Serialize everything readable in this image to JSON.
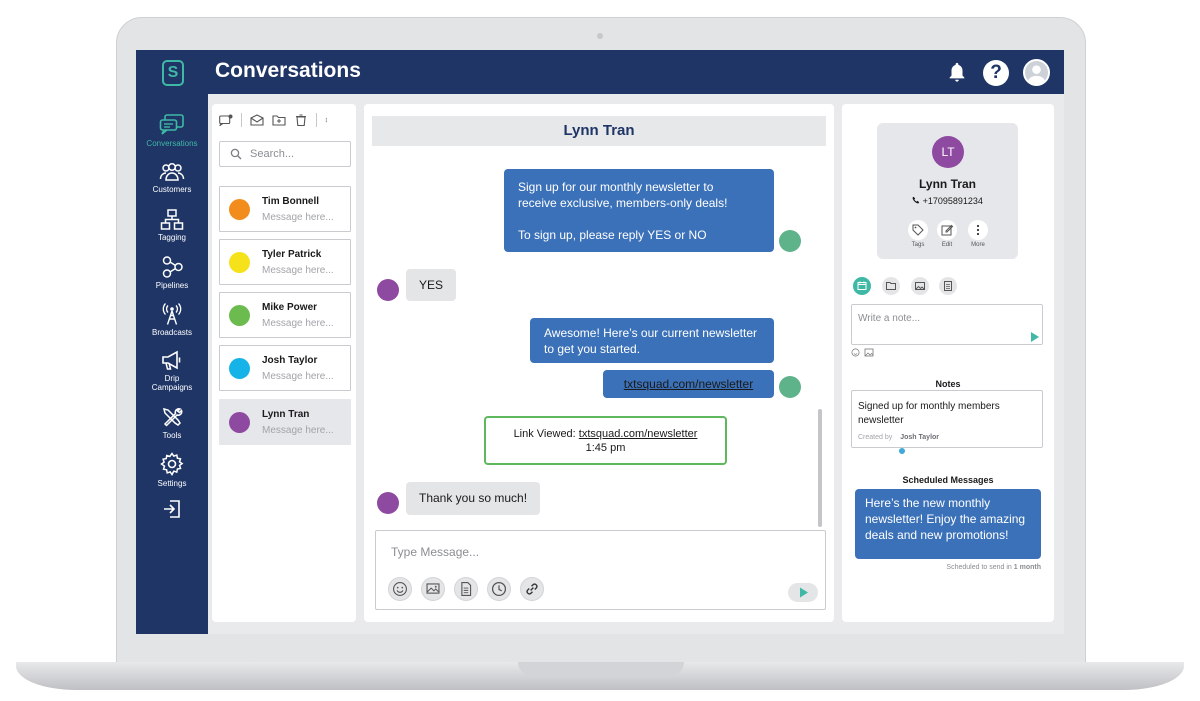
{
  "app": {
    "title": "Conversations"
  },
  "sidebar": {
    "items": [
      {
        "label": "Conversations",
        "icon": "chat-icon"
      },
      {
        "label": "Customers",
        "icon": "customers-icon"
      },
      {
        "label": "Tagging",
        "icon": "tagging-icon"
      },
      {
        "label": "Pipelines",
        "icon": "pipelines-icon"
      },
      {
        "label": "Broadcasts",
        "icon": "broadcast-icon"
      },
      {
        "label": "Drip",
        "label2": "Campaigns",
        "icon": "megaphone-icon"
      },
      {
        "label": "Tools",
        "icon": "tools-icon"
      },
      {
        "label": "Settings",
        "icon": "gear-icon"
      }
    ]
  },
  "list": {
    "search_placeholder": "Search...",
    "contacts": [
      {
        "name": "Tim Bonnell",
        "preview": "Message here...",
        "color": "#f28c1c"
      },
      {
        "name": "Tyler Patrick",
        "preview": "Message here...",
        "color": "#f6e21b"
      },
      {
        "name": "Mike Power",
        "preview": "Message here...",
        "color": "#6cbb4f"
      },
      {
        "name": "Josh Taylor",
        "preview": "Message here...",
        "color": "#16b3e8"
      },
      {
        "name": "Lynn Tran",
        "preview": "Message here...",
        "color": "#8e4aa1"
      }
    ]
  },
  "chat": {
    "contact_name": "Lynn Tran",
    "messages": {
      "m1_line1": "Sign up for our monthly newsletter to",
      "m1_line2": "receive exclusive, members-only deals!",
      "m1_line3": "To sign up, please reply YES or NO",
      "m2": "YES",
      "m3_line1": "Awesome! Here’s our current newsletter",
      "m3_line2": "to get you started.",
      "m4": "txtsquad.com/newsletter",
      "link_viewed_label": "Link Viewed:",
      "link_viewed_url": "txtsquad.com/newsletter",
      "link_viewed_time": "1:45 pm",
      "m5": "Thank you so much!"
    },
    "composer_placeholder": "Type Message..."
  },
  "contact": {
    "initials": "LT",
    "name": "Lynn Tran",
    "phone": "+17095891234",
    "actions": [
      "Tags",
      "Edit",
      "More"
    ],
    "note_placeholder": "Write a note...",
    "notes_title": "Notes",
    "note_text": "Signed up for monthly members newsletter",
    "note_created_label": "Created by",
    "note_author": "Josh Taylor",
    "scheduled_title": "Scheduled Messages",
    "scheduled_text": "Here’s the new monthly newsletter! Enjoy the amazing deals and new promotions!",
    "scheduled_prefix": "Scheduled to send in",
    "scheduled_when": "1 month"
  },
  "colors": {
    "navy": "#1f3566",
    "accent": "#3fb8a5",
    "bubble_blue": "#3b71b8",
    "link_green": "#5eb85d"
  }
}
